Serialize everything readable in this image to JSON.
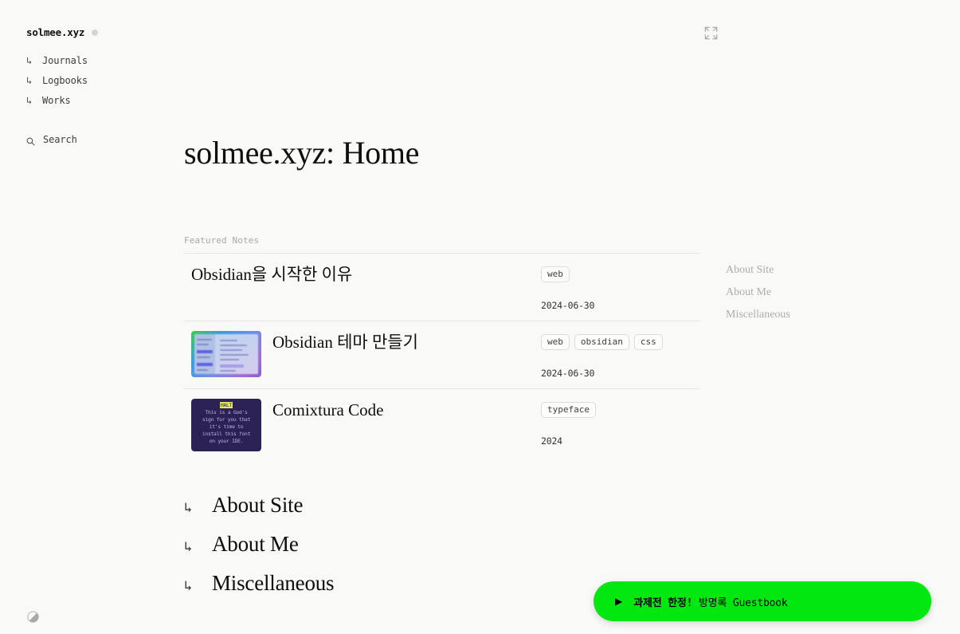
{
  "site": {
    "brand": "solmee.xyz",
    "status_dot_color": "#d4d4d0"
  },
  "sidebar": {
    "nav_arrow_glyph": "↳",
    "items": [
      {
        "label": "Journals"
      },
      {
        "label": "Logbooks"
      },
      {
        "label": "Works"
      }
    ],
    "search": {
      "label": "Search",
      "icon": "search-icon"
    },
    "theme_toggle_icon": "half-circle-theme-icon"
  },
  "header": {
    "expand_icon": "expand-fullscreen-icon"
  },
  "main": {
    "title": "solmee.xyz: Home",
    "featured": {
      "label": "Featured Notes",
      "notes": [
        {
          "title": "Obsidian을 시작한 이유",
          "tags": [
            "web"
          ],
          "date": "2024-06-30",
          "has_thumbnail": false
        },
        {
          "title": "Obsidian 테마 만들기",
          "tags": [
            "web",
            "obsidian",
            "css"
          ],
          "date": "2024-06-30",
          "has_thumbnail": true
        },
        {
          "title": "Comixtura Code",
          "tags": [
            "typeface"
          ],
          "date": "2024",
          "has_thumbnail": true,
          "thumbnail_text": [
            "HALT",
            "This is a God's",
            "sign for you that",
            "it's time to",
            "install this font",
            "on your IDE."
          ]
        }
      ]
    },
    "side_links": [
      {
        "label": "About Site"
      },
      {
        "label": "About Me"
      },
      {
        "label": "Miscellaneous"
      }
    ],
    "big_links": {
      "arrow_glyph": "↳",
      "items": [
        {
          "label": "About Site"
        },
        {
          "label": "About Me"
        },
        {
          "label": "Miscellaneous"
        }
      ]
    }
  },
  "guestbook": {
    "play_glyph": "▶",
    "strong_text": "과제전 한정!",
    "rest_text": " 방명록 Guestbook",
    "background_color": "#00e810"
  }
}
